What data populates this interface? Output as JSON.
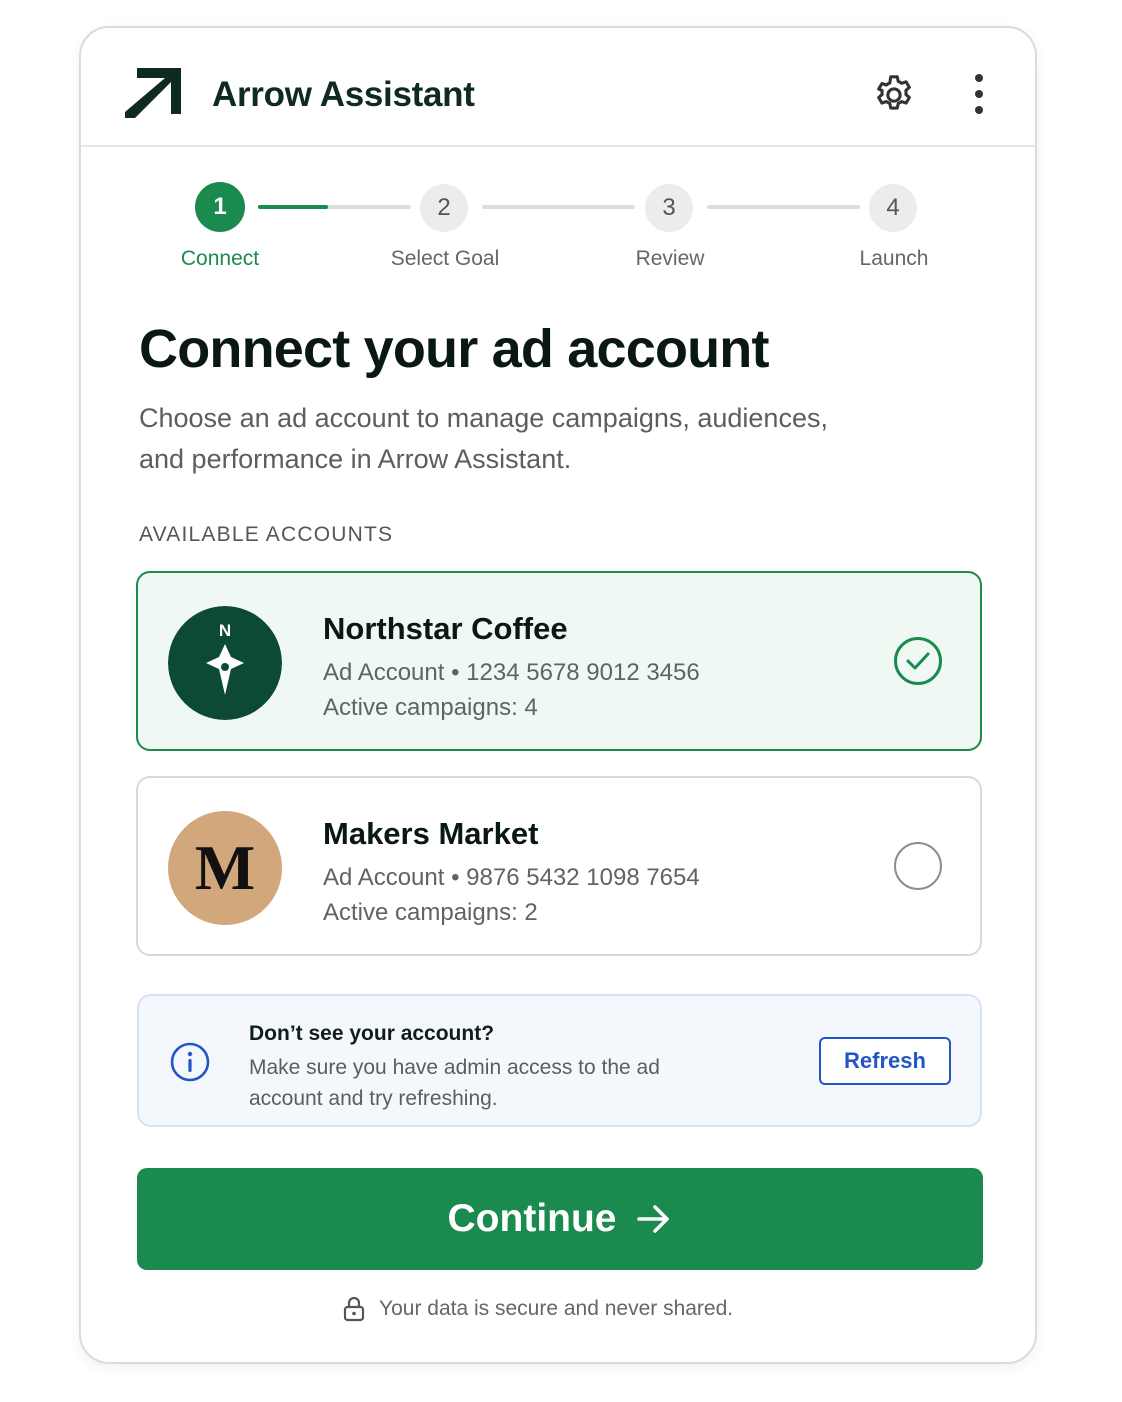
{
  "app": {
    "title": "Arrow Assistant"
  },
  "stepper": {
    "steps": [
      {
        "number": "1",
        "label": "Connect"
      },
      {
        "number": "2",
        "label": "Select Goal"
      },
      {
        "number": "3",
        "label": "Review"
      },
      {
        "number": "4",
        "label": "Launch"
      }
    ]
  },
  "page": {
    "title": "Connect your ad account",
    "subtitle": "Choose an ad account to manage campaigns, audiences, and performance in Arrow Assistant.",
    "section_label": "AVAILABLE ACCOUNTS"
  },
  "accounts": [
    {
      "name": "Northstar Coffee",
      "number_line": "Ad Account • 1234 5678 9012 3456",
      "campaigns": "Active campaigns: 4",
      "avatar_letter": "N"
    },
    {
      "name": "Makers Market",
      "number_line": "Ad Account • 9876 5432 1098 7654",
      "campaigns": "Active campaigns: 2",
      "avatar_letter": "M"
    }
  ],
  "info": {
    "title": "Don’t see your account?",
    "text": "Make sure you have admin access to the ad account and try refreshing.",
    "refresh_label": "Refresh"
  },
  "continue_label": "Continue",
  "secure_note": "Your data is secure and never shared.",
  "colors": {
    "brand": "#1a8a4f",
    "brand_dark": "#0d4a33",
    "link": "#2356c4",
    "makers_avatar": "#d2a77c"
  }
}
